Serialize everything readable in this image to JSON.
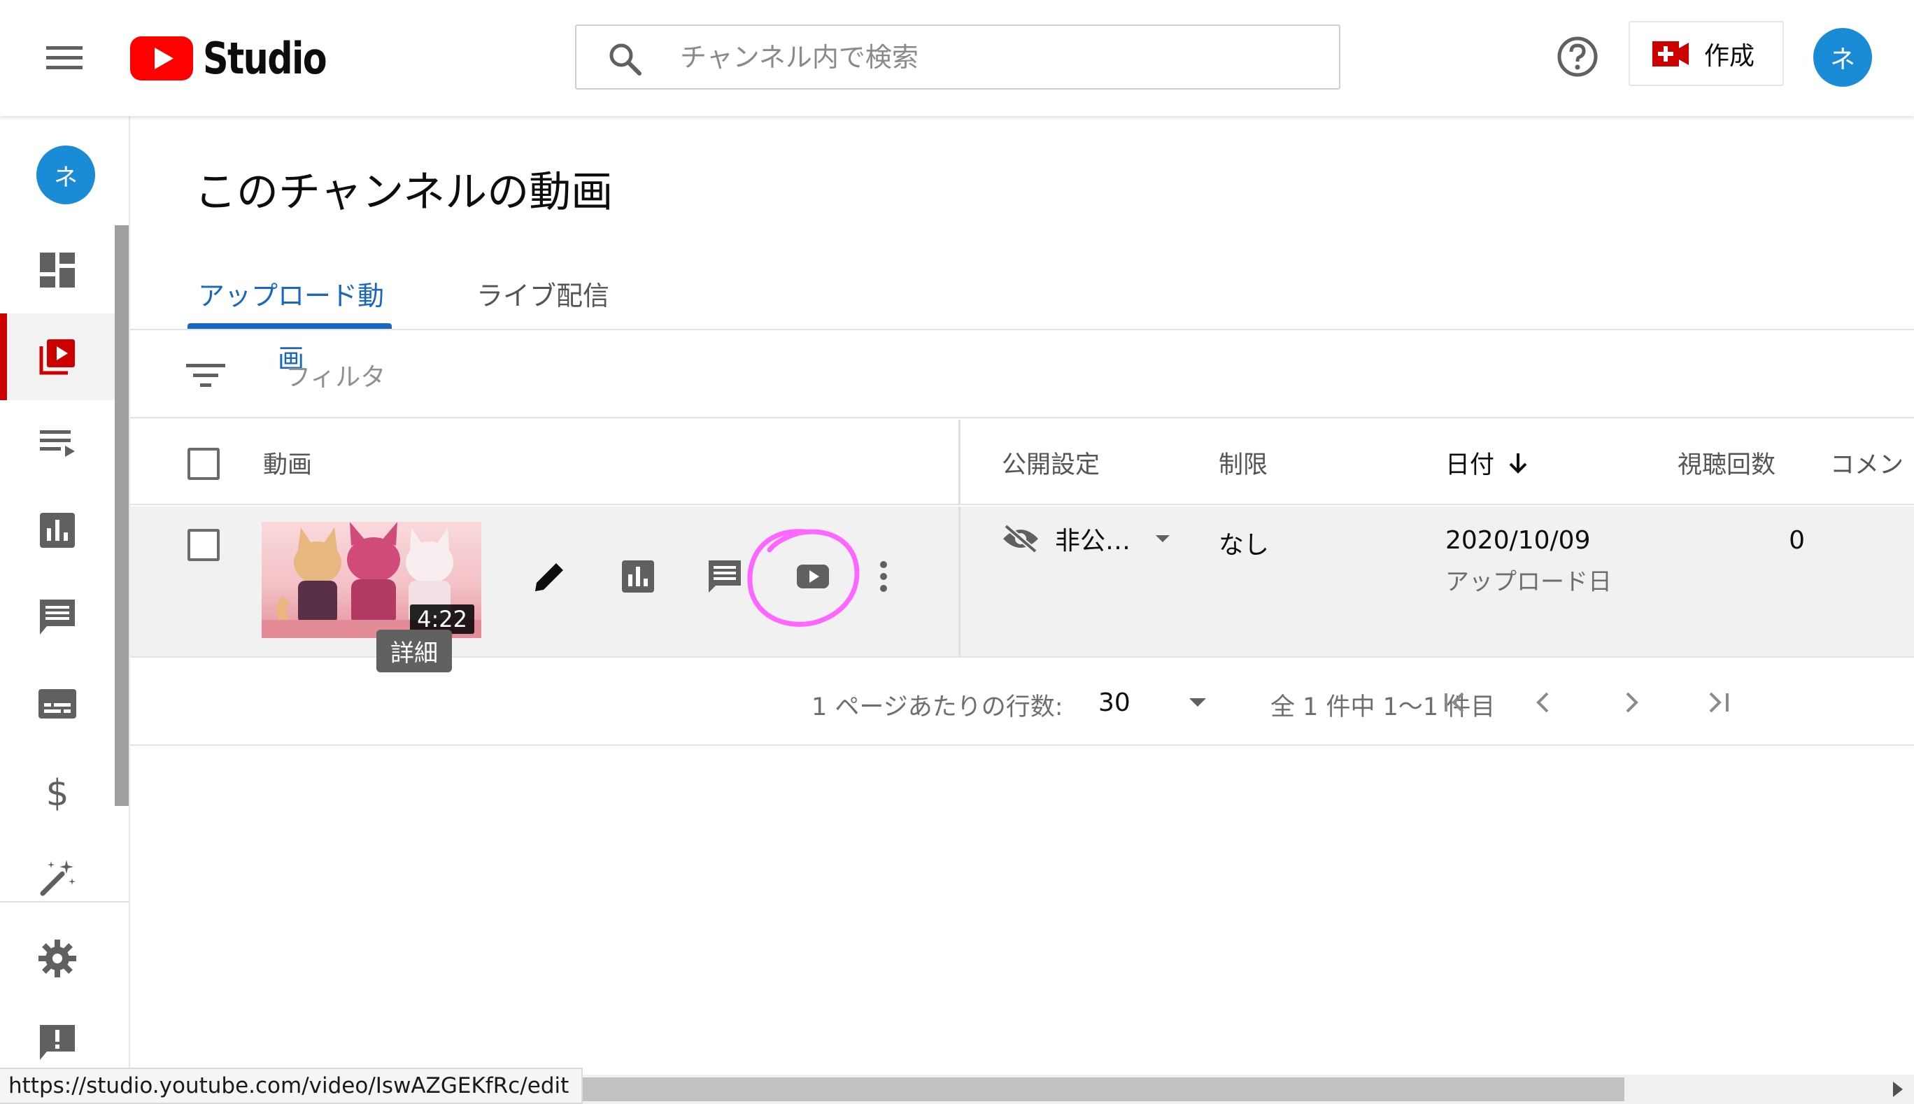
{
  "header": {
    "logo_text": "Studio",
    "search_placeholder": "チャンネル内で検索",
    "create_label": "作成",
    "avatar_initial": "ネ"
  },
  "sidebar": {
    "avatar_initial": "ネ",
    "items": [
      {
        "name": "dashboard",
        "icon": "dashboard-icon",
        "active": false
      },
      {
        "name": "content",
        "icon": "video-library-icon",
        "active": true
      },
      {
        "name": "playlists",
        "icon": "playlist-icon",
        "active": false
      },
      {
        "name": "analytics",
        "icon": "analytics-icon",
        "active": false
      },
      {
        "name": "comments",
        "icon": "comment-icon",
        "active": false
      },
      {
        "name": "subtitles",
        "icon": "subtitles-icon",
        "active": false
      },
      {
        "name": "monetization",
        "icon": "dollar-icon",
        "active": false
      },
      {
        "name": "customization",
        "icon": "magic-wand-icon",
        "active": false
      },
      {
        "name": "settings",
        "icon": "gear-icon",
        "active": false
      },
      {
        "name": "feedback",
        "icon": "feedback-icon",
        "active": false
      }
    ]
  },
  "page": {
    "title": "このチャンネルの動画",
    "tabs": [
      {
        "label": "アップロード動画",
        "active": true
      },
      {
        "label": "ライブ配信",
        "active": false
      }
    ],
    "filter_label": "フィルタ"
  },
  "table": {
    "headers": {
      "video": "動画",
      "visibility": "公開設定",
      "restrictions": "制限",
      "date": "日付",
      "views": "視聴回数",
      "comments": "コメン"
    },
    "rows": [
      {
        "duration": "4:22",
        "visibility": "非公…",
        "restrictions": "なし",
        "date": "2020/10/09",
        "date_sub": "アップロード日",
        "views": "0",
        "tooltip": "詳細"
      }
    ]
  },
  "pagination": {
    "rows_per_page_label": "1 ページあたりの行数:",
    "rows_per_page_value": "30",
    "range_text": "全 1 件中 1〜1 件目"
  },
  "status_bar": {
    "url": "https://studio.youtube.com/video/IswAZGEKfRc/edit"
  },
  "colors": {
    "accent_blue": "#1967c0",
    "brand_red": "#ff0000",
    "active_red": "#cc0000",
    "avatar_blue": "#1a8bd6",
    "highlight_magenta": "#ff66ff"
  }
}
